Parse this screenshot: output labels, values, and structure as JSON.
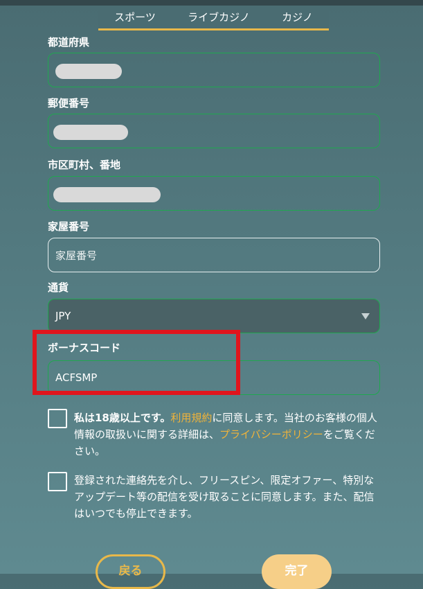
{
  "tabs": [
    {
      "label": "スポーツ"
    },
    {
      "label": "ライブカジノ"
    },
    {
      "label": "カジノ"
    }
  ],
  "form": {
    "prefecture": {
      "label": "都道府県"
    },
    "postal_code": {
      "label": "郵便番号"
    },
    "city": {
      "label": "市区町村、番地"
    },
    "house_number": {
      "label": "家屋番号",
      "placeholder": "家屋番号"
    },
    "currency": {
      "label": "通貨",
      "value": "JPY"
    },
    "bonus_code": {
      "label": "ボーナスコード",
      "value": "ACFSMP"
    }
  },
  "consent_age": {
    "bold": "私は18歳以上です。",
    "link1": "利用規約",
    "mid": "に同意します。当社のお客様の個人情報の取扱いに関する詳細は、",
    "link2": "プライバシーポリシー",
    "tail": "をご覧ください。"
  },
  "consent_marketing": {
    "text": "登録された連絡先を介し、フリースピン、限定オファー、特別なアップデート等の配信を受け取ることに同意します。また、配信はいつでも停止できます。"
  },
  "buttons": {
    "back": "戻る",
    "done": "完了"
  },
  "colors": {
    "accent": "#e8b84a",
    "link": "#f0b33a",
    "field_border": "#1fa84f",
    "highlight": "#e0151d"
  }
}
